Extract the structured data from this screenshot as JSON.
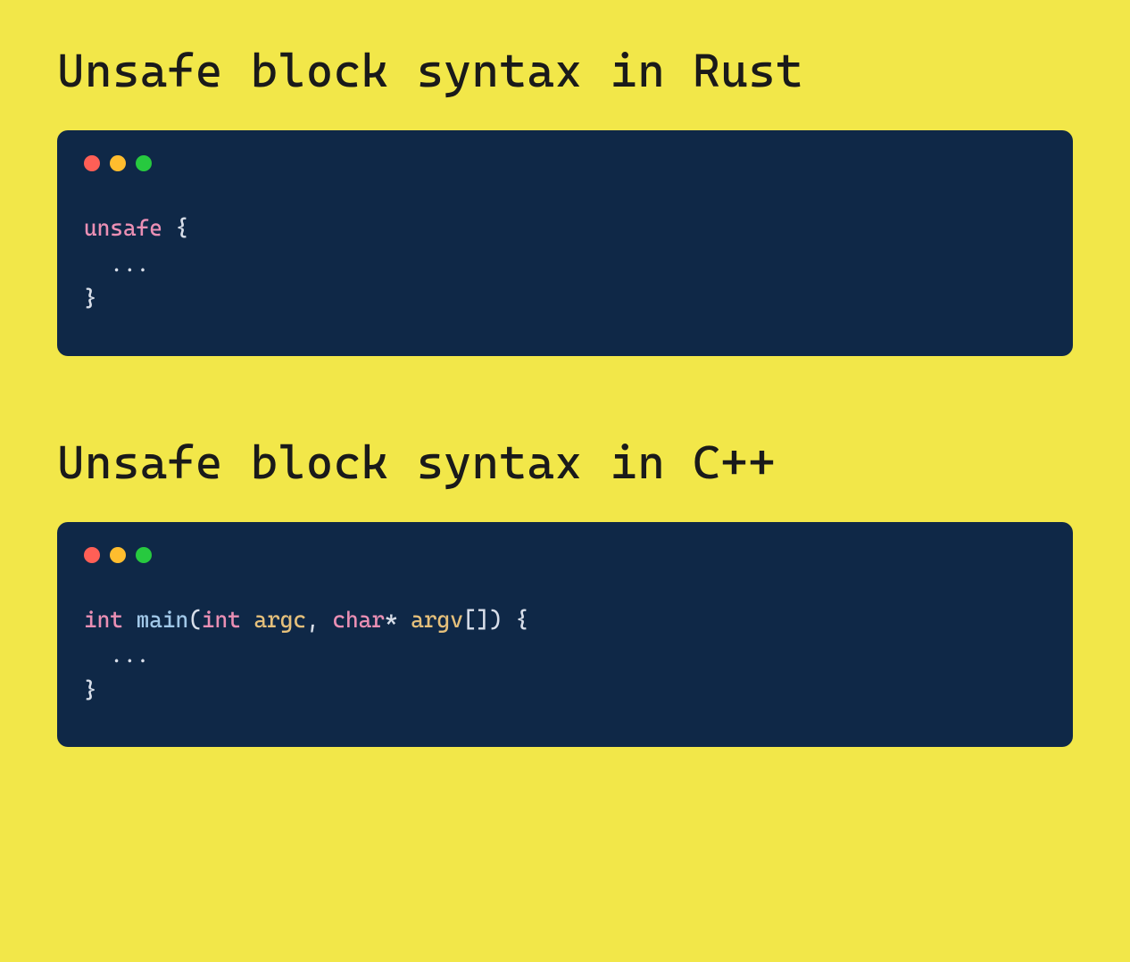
{
  "sections": [
    {
      "title": "Unsafe block syntax in Rust",
      "code": {
        "tokens": [
          {
            "cls": "tok-keyword",
            "text": "unsafe"
          },
          {
            "cls": "tok-punct",
            "text": " {"
          },
          {
            "cls": "tok-text",
            "text": "\n  ..."
          },
          {
            "cls": "tok-punct",
            "text": "\n}"
          }
        ]
      }
    },
    {
      "title": "Unsafe block syntax in C++",
      "code": {
        "tokens": [
          {
            "cls": "tok-type",
            "text": "int"
          },
          {
            "cls": "tok-text",
            "text": " "
          },
          {
            "cls": "tok-func",
            "text": "main"
          },
          {
            "cls": "tok-punct",
            "text": "("
          },
          {
            "cls": "tok-type",
            "text": "int"
          },
          {
            "cls": "tok-text",
            "text": " "
          },
          {
            "cls": "tok-param",
            "text": "argc"
          },
          {
            "cls": "tok-punct",
            "text": ", "
          },
          {
            "cls": "tok-type",
            "text": "char"
          },
          {
            "cls": "tok-punct",
            "text": "* "
          },
          {
            "cls": "tok-param",
            "text": "argv"
          },
          {
            "cls": "tok-punct",
            "text": "[]) {"
          },
          {
            "cls": "tok-text",
            "text": "\n  ..."
          },
          {
            "cls": "tok-punct",
            "text": "\n}"
          }
        ]
      }
    }
  ]
}
